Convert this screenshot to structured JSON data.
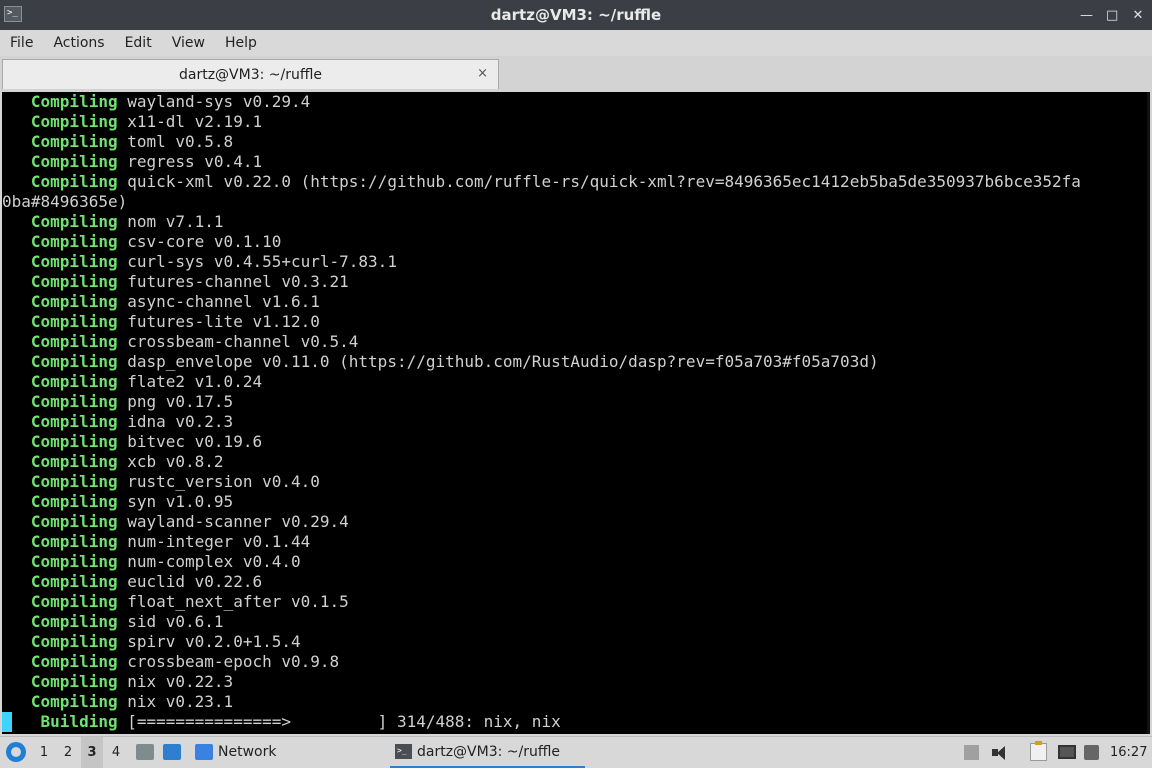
{
  "window": {
    "title": "dartz@VM3: ~/ruffle",
    "app_icon": "terminal-icon",
    "controls": [
      "minimize-icon",
      "restore-icon",
      "close-icon"
    ]
  },
  "menu": {
    "items": [
      "File",
      "Actions",
      "Edit",
      "View",
      "Help"
    ]
  },
  "tab": {
    "label": "dartz@VM3: ~/ruffle",
    "close_glyph": "×"
  },
  "terminal": {
    "keyword_color": "#6ee36e",
    "cursor_color": "#3fd3ff",
    "lines": [
      {
        "kw": "   Compiling",
        "text": " wayland-sys v0.29.4"
      },
      {
        "kw": "   Compiling",
        "text": " x11-dl v2.19.1"
      },
      {
        "kw": "   Compiling",
        "text": " toml v0.5.8"
      },
      {
        "kw": "   Compiling",
        "text": " regress v0.4.1"
      },
      {
        "kw": "   Compiling",
        "text": " quick-xml v0.22.0 (https://github.com/ruffle-rs/quick-xml?rev=8496365ec1412eb5ba5de350937b6bce352fa"
      },
      {
        "kw": "",
        "text": "0ba#8496365e)"
      },
      {
        "kw": "   Compiling",
        "text": " nom v7.1.1"
      },
      {
        "kw": "   Compiling",
        "text": " csv-core v0.1.10"
      },
      {
        "kw": "   Compiling",
        "text": " curl-sys v0.4.55+curl-7.83.1"
      },
      {
        "kw": "   Compiling",
        "text": " futures-channel v0.3.21"
      },
      {
        "kw": "   Compiling",
        "text": " async-channel v1.6.1"
      },
      {
        "kw": "   Compiling",
        "text": " futures-lite v1.12.0"
      },
      {
        "kw": "   Compiling",
        "text": " crossbeam-channel v0.5.4"
      },
      {
        "kw": "   Compiling",
        "text": " dasp_envelope v0.11.0 (https://github.com/RustAudio/dasp?rev=f05a703#f05a703d)"
      },
      {
        "kw": "   Compiling",
        "text": " flate2 v1.0.24"
      },
      {
        "kw": "   Compiling",
        "text": " png v0.17.5"
      },
      {
        "kw": "   Compiling",
        "text": " idna v0.2.3"
      },
      {
        "kw": "   Compiling",
        "text": " bitvec v0.19.6"
      },
      {
        "kw": "   Compiling",
        "text": " xcb v0.8.2"
      },
      {
        "kw": "   Compiling",
        "text": " rustc_version v0.4.0"
      },
      {
        "kw": "   Compiling",
        "text": " syn v1.0.95"
      },
      {
        "kw": "   Compiling",
        "text": " wayland-scanner v0.29.4"
      },
      {
        "kw": "   Compiling",
        "text": " num-integer v0.1.44"
      },
      {
        "kw": "   Compiling",
        "text": " num-complex v0.4.0"
      },
      {
        "kw": "   Compiling",
        "text": " euclid v0.22.6"
      },
      {
        "kw": "   Compiling",
        "text": " float_next_after v0.1.5"
      },
      {
        "kw": "   Compiling",
        "text": " sid v0.6.1"
      },
      {
        "kw": "   Compiling",
        "text": " spirv v0.2.0+1.5.4"
      },
      {
        "kw": "   Compiling",
        "text": " crossbeam-epoch v0.9.8"
      },
      {
        "kw": "   Compiling",
        "text": " nix v0.22.3"
      },
      {
        "kw": "   Compiling",
        "text": " nix v0.23.1"
      },
      {
        "kw": "    Building",
        "text": " [===============>         ] 314/488: nix, nix"
      }
    ]
  },
  "taskbar": {
    "start_icon": "lxqt-menu-icon",
    "workspaces": [
      "1",
      "2",
      "3",
      "4"
    ],
    "active_workspace": "3",
    "quicklaunch_icons": [
      "file-manager-icon",
      "show-desktop-icon",
      "folder-icon"
    ],
    "network_label": "Network",
    "task_label": "dartz@VM3: ~/ruffle",
    "tray_icons": [
      "tray-expand-icon",
      "volume-icon",
      "clipboard-icon",
      "network-status-icon",
      "display-icon"
    ],
    "clock": "16:27"
  }
}
